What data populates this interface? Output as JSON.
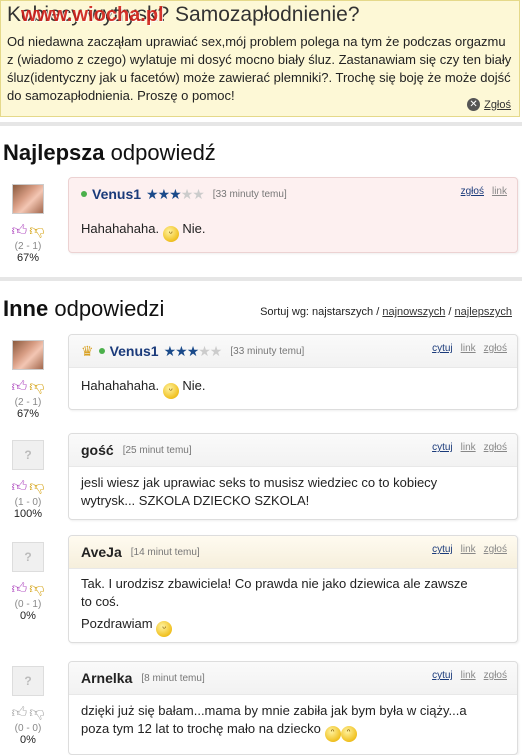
{
  "question": {
    "title": "Kobiecy wytrysk? Samozapłodnienie?",
    "watermark": "www.wiocha.pl",
    "body": "Od niedawna zacząłam uprawiać sex,mój problem polega na tym że podczas orgazmu z (wiadomo z czego) wylatuje mi dosyć mocno biały śluz. Zastanawiam się czy ten biały śluz(identyczny jak u facetów) może zawierać plemniki?. Trochę się boję że może dojść do samozapłodnienia. Proszę o pomoc!",
    "report_label": "Zgłoś"
  },
  "best": {
    "heading_bold": "Najlepsza",
    "heading_rest": " odpowiedź",
    "answer": {
      "user": "Venus1",
      "stars_on": "★★★",
      "stars_off": "★★",
      "time": "[33 minuty temu]",
      "actions": [
        "zgłoś",
        "link"
      ],
      "text": "Hahahahaha.",
      "text_after": " Nie.",
      "votes": "(2 - 1)",
      "percent": "67%"
    }
  },
  "others": {
    "heading_bold": "Inne",
    "heading_rest": " odpowiedzi",
    "sort_prefix": "Sortuj wg: najstarszych / ",
    "sort_newest": "najnowszych",
    "sort_sep": " / ",
    "sort_best": "najlepszych",
    "answers": [
      {
        "user": "Venus1",
        "stars_on": "★★★",
        "stars_off": "★★",
        "time": "[33 minuty temu]",
        "actions": [
          "cytuj",
          "link",
          "zgłoś"
        ],
        "line1": "Hahahahaha.",
        "line1_after": " Nie.",
        "votes": "(2 - 1)",
        "percent": "67%"
      },
      {
        "user": "gość",
        "time": "[25 minut temu]",
        "actions": [
          "cytuj",
          "link",
          "zgłoś"
        ],
        "line1": "jesli wiesz jak uprawiac seks to musisz wiedziec co to kobiecy",
        "line2": "wytrysk... SZKOLA DZIECKO SZKOLA!",
        "votes": "(1 - 0)",
        "percent": "100%"
      },
      {
        "user": "AveJa",
        "time": "[14 minut temu]",
        "actions": [
          "cytuj",
          "link",
          "zgłoś"
        ],
        "line1": "Tak. I urodzisz zbawiciela! Co prawda nie jako dziewica ale zawsze",
        "line2": "to coś.",
        "line3": "Pozdrawiam",
        "votes": "(0 - 1)",
        "percent": "0%"
      },
      {
        "user": "Arnelka",
        "time": "[8 minut temu]",
        "actions": [
          "cytuj",
          "link",
          "zgłoś"
        ],
        "line1": "dzięki już się bałam...mama by mnie zabiła jak bym była w ciąży...a",
        "line2": "poza tym 12 lat to trochę mało na dziecko",
        "votes": "(0 - 0)",
        "percent": "0%"
      }
    ]
  },
  "icons": {
    "thumb_up": "thumb-up-icon",
    "thumb_down": "thumb-down-icon",
    "report": "close-circle-icon",
    "online": "online-dot-icon",
    "crown": "crown-icon",
    "smiley": "smiley-icon",
    "avatar_blank": "avatar-placeholder-icon"
  },
  "colors": {
    "question_bg": "#fdf8d6",
    "best_card_bg": "#fdf0f0",
    "username": "#1a3a7a",
    "thumb_up": "#b04cc0",
    "thumb_down": "#d6a51a",
    "watermark": "#d0201a"
  }
}
